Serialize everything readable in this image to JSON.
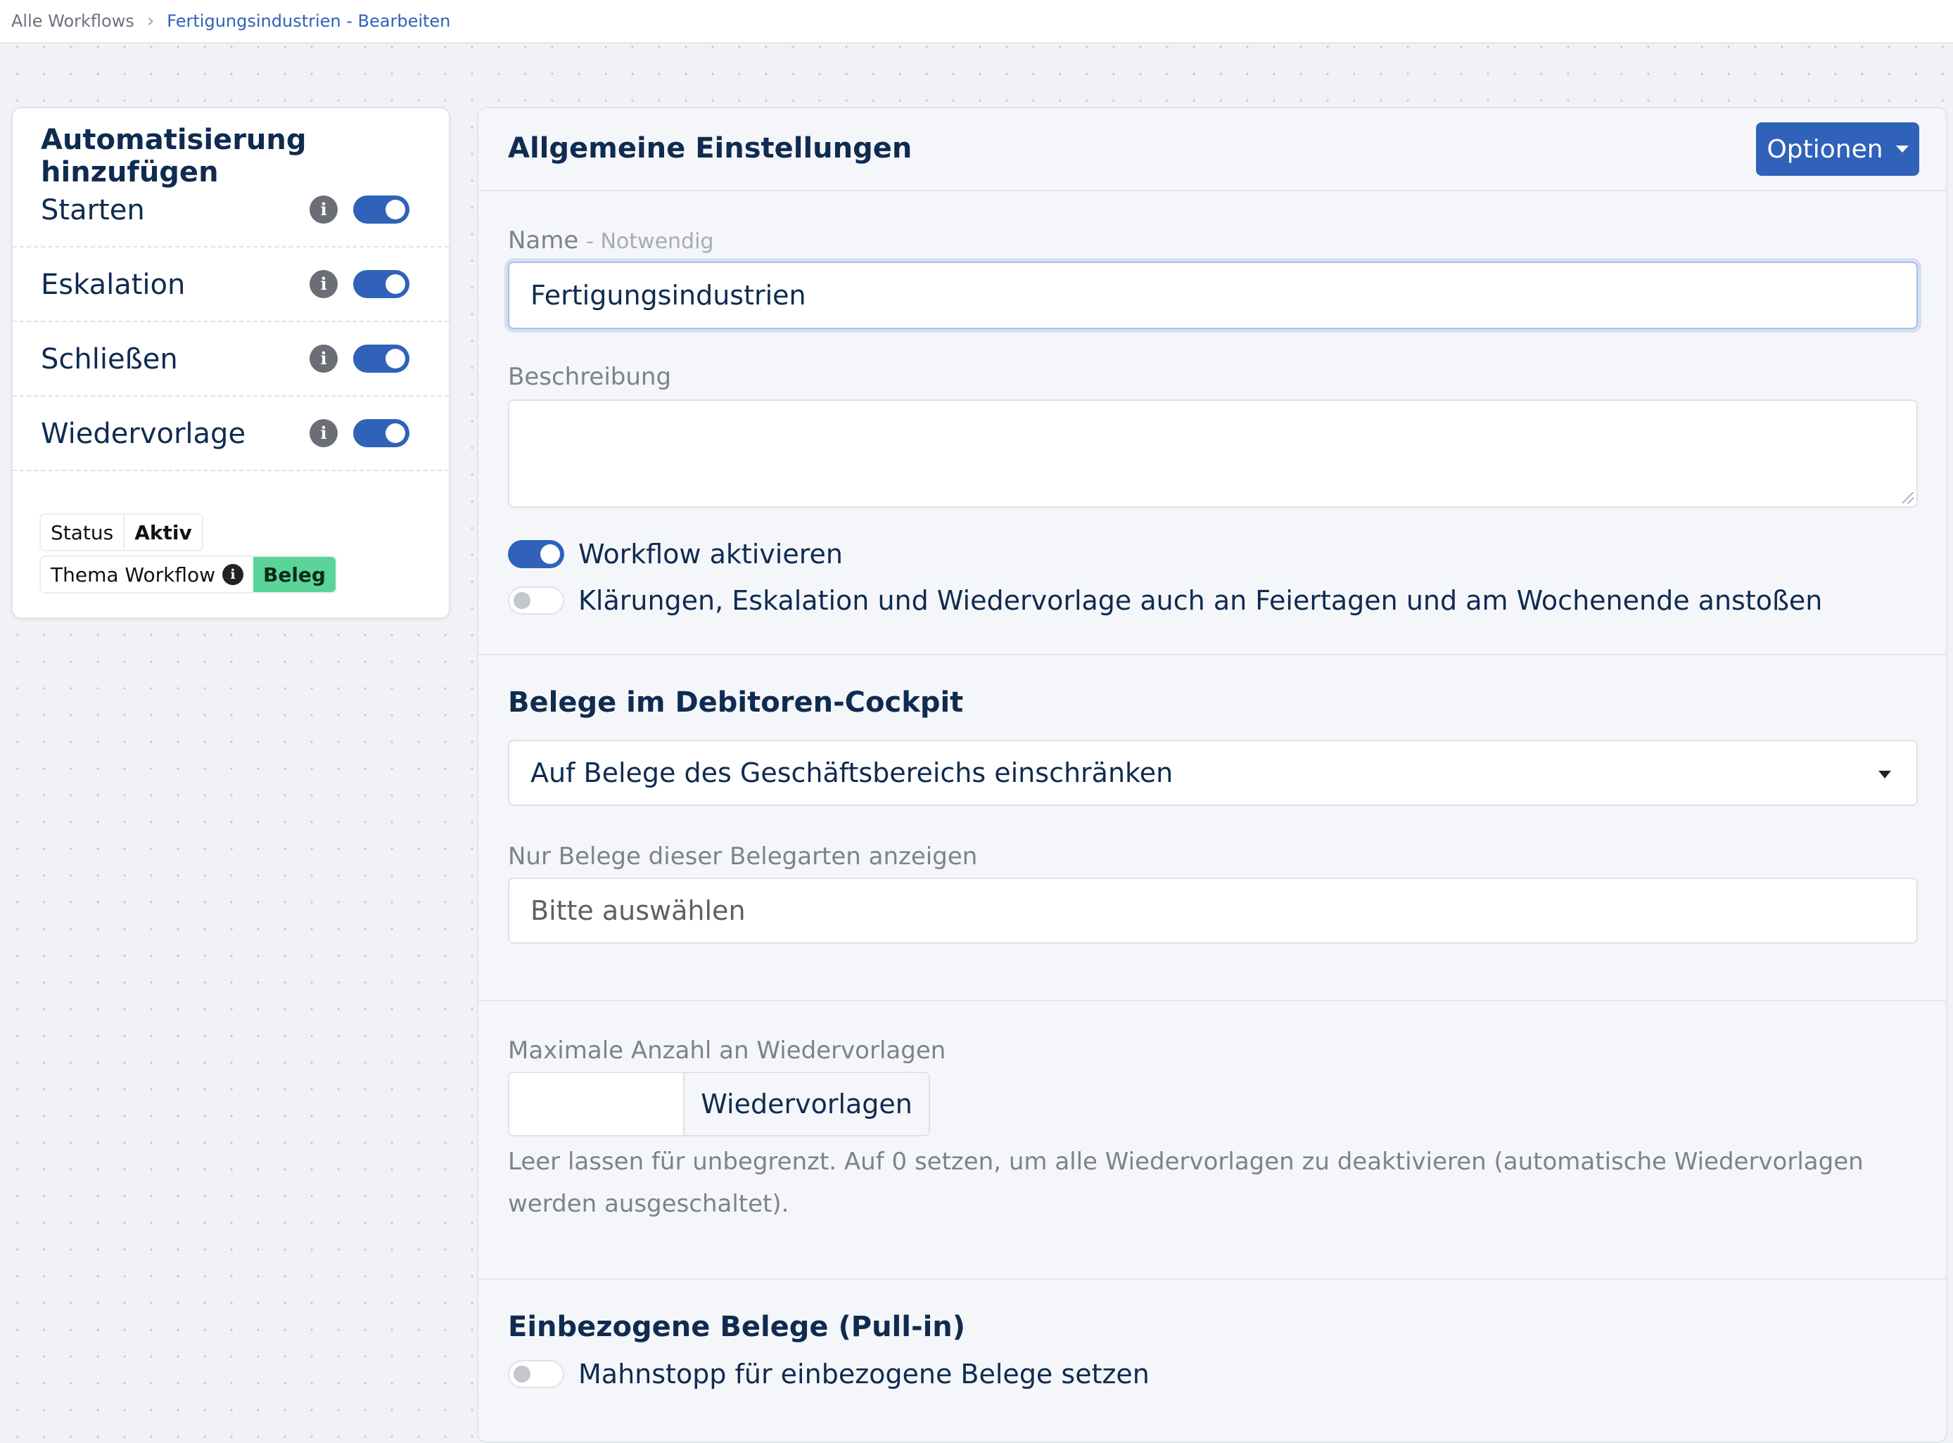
{
  "breadcrumb": {
    "root": "Alle Workflows",
    "current": "Fertigungsindustrien - Bearbeiten"
  },
  "automation": {
    "title": "Automatisierung hinzufügen",
    "items": [
      {
        "label": "Starten",
        "enabled": true
      },
      {
        "label": "Eskalation",
        "enabled": true
      },
      {
        "label": "Schließen",
        "enabled": true
      },
      {
        "label": "Wiedervorlage",
        "enabled": true
      }
    ],
    "status_key": "Status",
    "status_value": "Aktiv",
    "theme_key": "Thema Workflow",
    "theme_value": "Beleg"
  },
  "general": {
    "title": "Allgemeine Einstellungen",
    "options_label": "Optionen",
    "name_label": "Name",
    "name_required": "- Notwendig",
    "name_value": "Fertigungsindustrien",
    "description_label": "Beschreibung",
    "description_value": "",
    "activate_label": "Workflow aktivieren",
    "activate_on": true,
    "holiday_label": "Klärungen, Eskalation und Wiedervorlage auch an Feiertagen und am Wochenende anstoßen",
    "holiday_on": false
  },
  "documents": {
    "title": "Belege im Debitoren-Cockpit",
    "restrict_selected": "Auf Belege des Geschäftsbereichs einschränken",
    "types_label": "Nur Belege dieser Belegarten anzeigen",
    "types_placeholder": "Bitte auswählen"
  },
  "followups": {
    "max_label": "Maximale Anzahl an Wiedervorlagen",
    "max_value": "",
    "addon": "Wiedervorlagen",
    "help": "Leer lassen für unbegrenzt. Auf 0 setzen, um alle Wiedervorlagen zu deaktivieren (automatische Wiedervorlagen werden ausgeschaltet)."
  },
  "pullin": {
    "title": "Einbezogene Belege (Pull-in)",
    "dunning_label": "Mahnstopp für einbezogene Belege setzen",
    "dunning_on": false
  },
  "colors": {
    "primary": "#2f62b8",
    "heading": "#0f2b50",
    "badge_green": "#5bd49a"
  },
  "icons": {
    "breadcrumb_separator": "chevron-right-icon",
    "info": "info-icon",
    "dropdown": "caret-down-icon"
  }
}
